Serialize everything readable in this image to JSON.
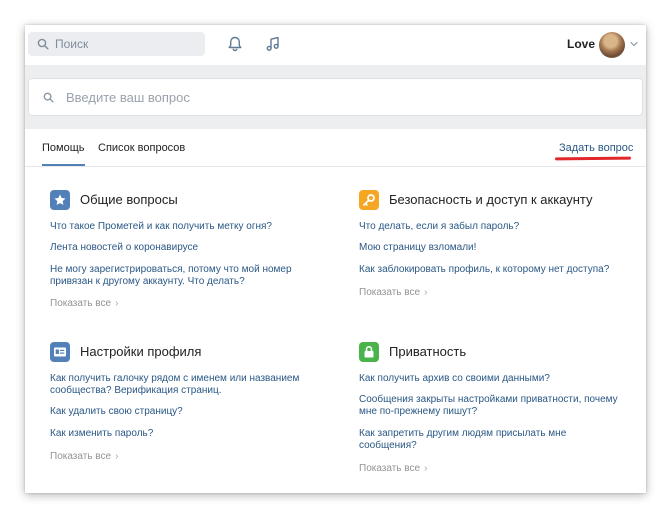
{
  "header": {
    "search_placeholder": "Поиск",
    "user_name": "Love"
  },
  "question_search": {
    "placeholder": "Введите ваш вопрос"
  },
  "tabs": [
    {
      "label": "Помощь",
      "active": true
    },
    {
      "label": "Список вопросов",
      "active": false
    }
  ],
  "ask_link": "Задать вопрос",
  "sections": [
    {
      "title": "Общие вопросы",
      "icon": "star-icon",
      "icon_color": "#5181b8",
      "questions": [
        "Что такое Прометей и как получить метку огня?",
        "Лента новостей о коронавирусе",
        "Не могу зарегистрироваться, потому что мой номер привязан к другому аккаунту. Что делать?"
      ],
      "show_all": "Показать все"
    },
    {
      "title": "Безопасность и доступ к аккаунту",
      "icon": "key-icon",
      "icon_color": "#f5a623",
      "questions": [
        "Что делать, если я забыл пароль?",
        "Мою страницу взломали!",
        "Как заблокировать профиль, к которому нет доступа?"
      ],
      "show_all": "Показать все"
    },
    {
      "title": "Настройки профиля",
      "icon": "profile-card-icon",
      "icon_color": "#5181b8",
      "questions": [
        "Как получить галочку рядом с именем или названием сообщества? Верификация страниц.",
        "Как удалить свою страницу?",
        "Как изменить пароль?"
      ],
      "show_all": "Показать все"
    },
    {
      "title": "Приватность",
      "icon": "lock-icon",
      "icon_color": "#4bb34b",
      "questions": [
        "Как получить архив со своими данными?",
        "Сообщения закрыты настройками приватности, почему мне по-прежнему пишут?",
        "Как запретить другим людям присылать мне сообщения?"
      ],
      "show_all": "Показать все"
    }
  ]
}
